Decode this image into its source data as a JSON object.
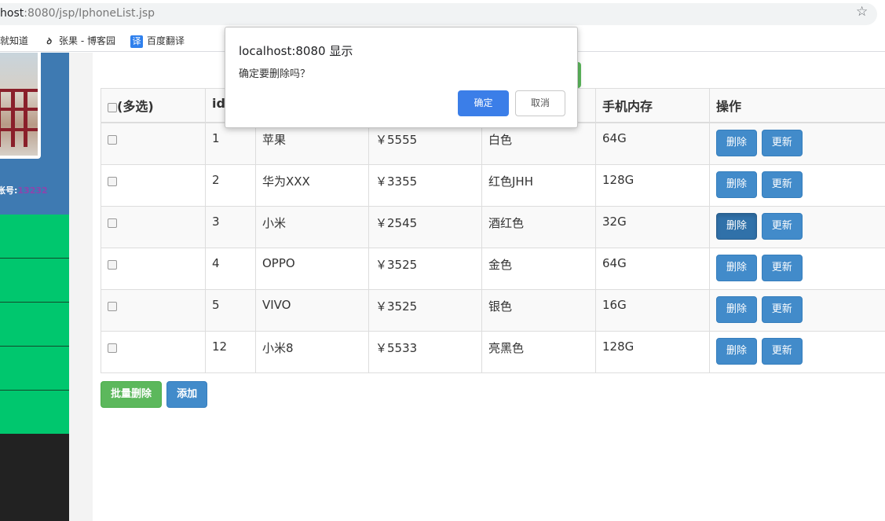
{
  "browser": {
    "url_host": "host",
    "url_rest": ":8080/jsp/IphoneList.jsp",
    "bookmarks": [
      "道就知道",
      "张果 - 博客园",
      "百度翻译"
    ],
    "bookmark_icons": [
      "baidu-zhidao-icon",
      "cnblogs-icon",
      "baidu-translate-icon"
    ]
  },
  "sidebar": {
    "account_label": "账号:",
    "account_number": "13232",
    "menu_count": 5
  },
  "table": {
    "headers": [
      "(多选)",
      "id",
      "",
      "",
      "",
      "手机内存",
      "操作"
    ],
    "rows": [
      {
        "id": "1",
        "name": "苹果",
        "price": "￥5555",
        "color": "白色",
        "memory": "64G"
      },
      {
        "id": "2",
        "name": "华为XXX",
        "price": "￥3355",
        "color": "红色JHH",
        "memory": "128G"
      },
      {
        "id": "3",
        "name": "小米",
        "price": "￥2545",
        "color": "酒红色",
        "memory": "32G"
      },
      {
        "id": "4",
        "name": "OPPO",
        "price": "￥3525",
        "color": "金色",
        "memory": "64G"
      },
      {
        "id": "5",
        "name": "VIVO",
        "price": "￥3525",
        "color": "银色",
        "memory": "16G"
      },
      {
        "id": "12",
        "name": "小米8",
        "price": "￥5533",
        "color": "亮黑色",
        "memory": "128G"
      }
    ],
    "delete_label": "删除",
    "update_label": "更新"
  },
  "actions": {
    "batch_delete": "批量删除",
    "add": "添加"
  },
  "dialog": {
    "title": "localhost:8080 显示",
    "message": "确定要删除吗？",
    "ok": "确定",
    "cancel": "取消"
  }
}
